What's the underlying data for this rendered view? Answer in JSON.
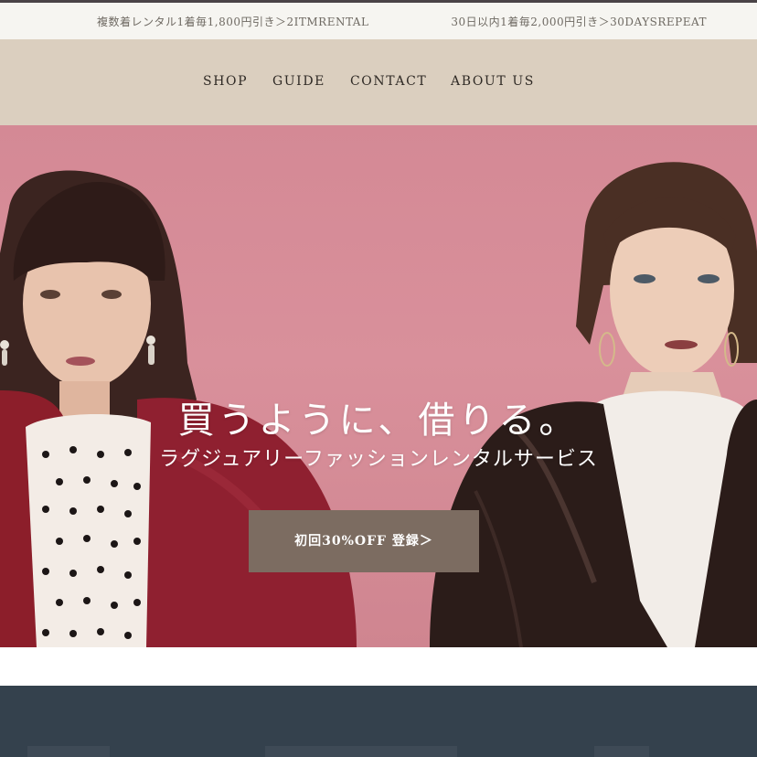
{
  "promo_bar": {
    "left_text": "複数着レンタル1着毎1,800円引き＞2ITMRENTAL",
    "right_text": "30日以内1着毎2,000円引き＞30DAYSREPEAT"
  },
  "nav": {
    "items": [
      {
        "label": "SHOP"
      },
      {
        "label": "GUIDE"
      },
      {
        "label": "CONTACT"
      },
      {
        "label": "ABOUT US"
      }
    ]
  },
  "hero": {
    "title": "買うように、借りる。",
    "subtitle": "ラグジュアリーファッションレンタルサービス",
    "cta_label": "初回30%OFF 登録＞"
  },
  "colors": {
    "promo_bg": "#f6f5f1",
    "nav_bg": "#dbcfbf",
    "hero_bg": "#d48995",
    "cta_bg": "#7c6c61",
    "footer_band": "#34414d"
  }
}
